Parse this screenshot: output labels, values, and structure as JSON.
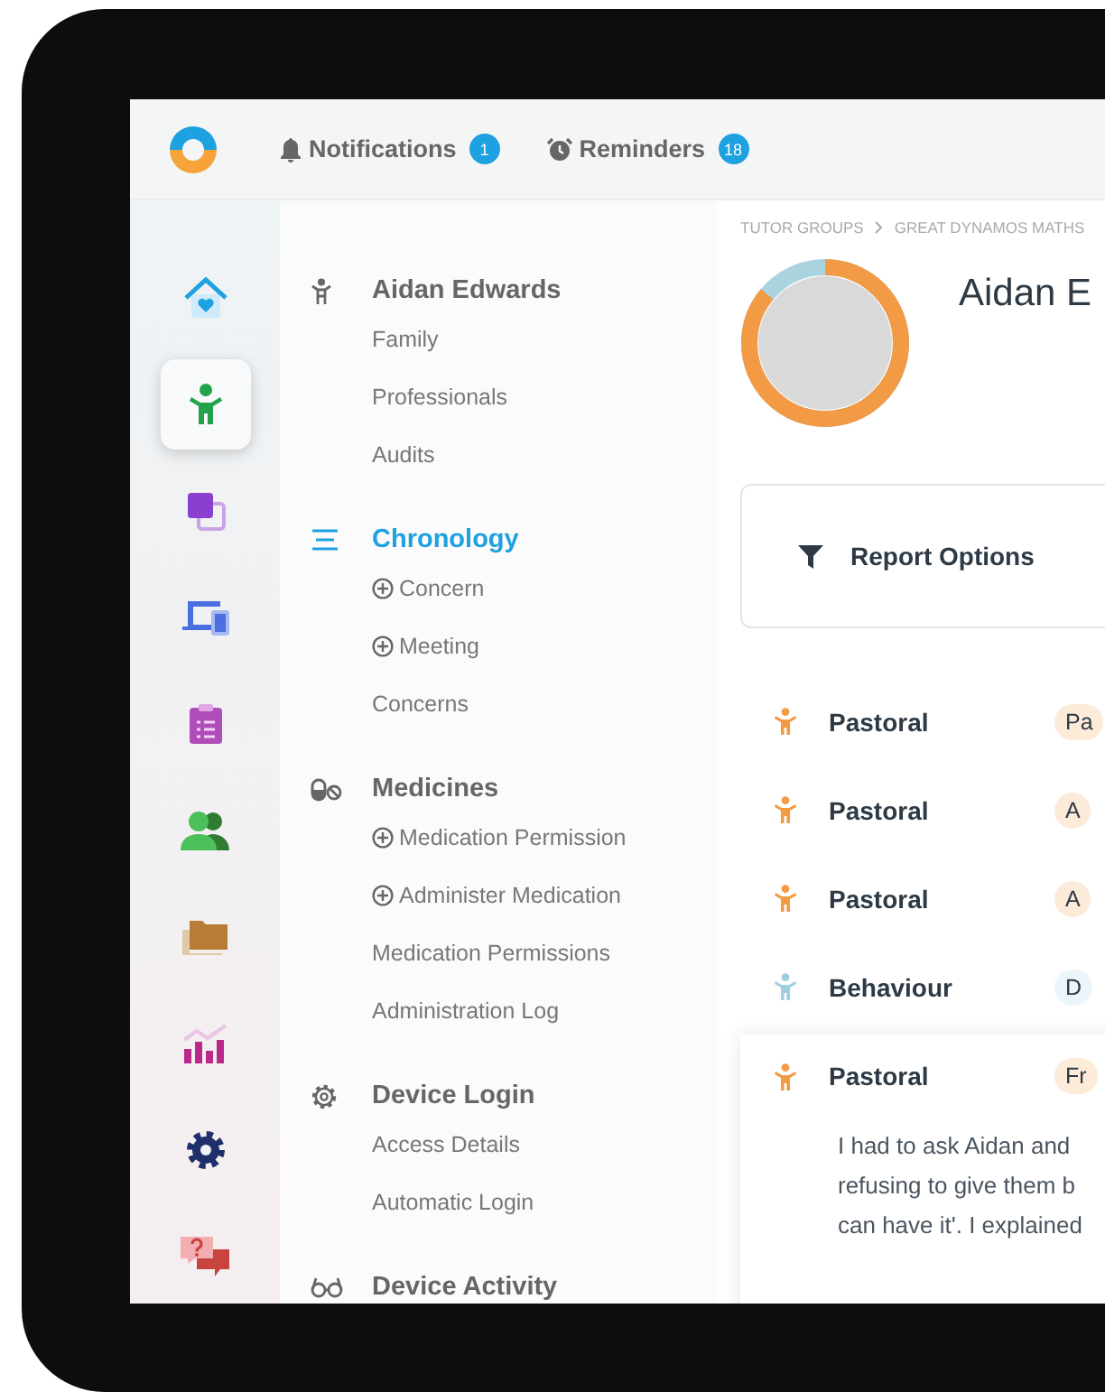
{
  "header": {
    "notifications": {
      "label": "Notifications",
      "count": "1"
    },
    "reminders": {
      "label": "Reminders",
      "count": "18"
    }
  },
  "rail": [
    {
      "kind": "home",
      "selected": false
    },
    {
      "kind": "person",
      "selected": true
    },
    {
      "kind": "squares",
      "selected": false
    },
    {
      "kind": "devices",
      "selected": false
    },
    {
      "kind": "clipboard",
      "selected": false
    },
    {
      "kind": "people",
      "selected": false
    },
    {
      "kind": "folder",
      "selected": false
    },
    {
      "kind": "chart",
      "selected": false
    },
    {
      "kind": "gear",
      "selected": false
    },
    {
      "kind": "chat",
      "selected": false
    }
  ],
  "nav": [
    {
      "kind": "person",
      "title": "Aidan Edwards",
      "selected": false,
      "items": [
        {
          "kind": "link",
          "label": "Family"
        },
        {
          "kind": "link",
          "label": "Professionals"
        },
        {
          "kind": "link",
          "label": "Audits"
        }
      ]
    },
    {
      "kind": "lines",
      "title": "Chronology",
      "selected": true,
      "items": [
        {
          "kind": "add",
          "label": "Concern"
        },
        {
          "kind": "add",
          "label": "Meeting"
        },
        {
          "kind": "link",
          "label": "Concerns"
        }
      ]
    },
    {
      "kind": "pill",
      "title": "Medicines",
      "selected": false,
      "items": [
        {
          "kind": "add",
          "label": "Medication Permission"
        },
        {
          "kind": "add",
          "label": "Administer Medication"
        },
        {
          "kind": "link",
          "label": "Medication Permissions"
        },
        {
          "kind": "link",
          "label": "Administration Log"
        }
      ]
    },
    {
      "kind": "gear",
      "title": "Device Login",
      "selected": false,
      "items": [
        {
          "kind": "link",
          "label": "Access Details"
        },
        {
          "kind": "link",
          "label": "Automatic Login"
        }
      ]
    },
    {
      "kind": "glasses",
      "title": "Device Activity",
      "selected": false
    }
  ],
  "breadcrumb": [
    "TUTOR GROUPS",
    "GREAT DYNAMOS MATHS"
  ],
  "profile": {
    "name": "Aidan E",
    "level": 0.86
  },
  "report_options": {
    "label": "Report Options"
  },
  "entries": [
    {
      "category": "Pastoral",
      "color": "#f39a45",
      "tag": "Pa",
      "expanded": false
    },
    {
      "category": "Pastoral",
      "color": "#f39a45",
      "tag": "A",
      "expanded": false
    },
    {
      "category": "Pastoral",
      "color": "#f39a45",
      "tag": "A",
      "expanded": false
    },
    {
      "category": "Behaviour",
      "color": "#9fcfdf",
      "tag": "D",
      "expanded": false
    },
    {
      "category": "Pastoral",
      "color": "#f39a45",
      "tag": "Fr",
      "expanded": true,
      "text": [
        "I had to ask Aidan and",
        "refusing to give them b",
        "can have it'. I explained"
      ]
    }
  ]
}
